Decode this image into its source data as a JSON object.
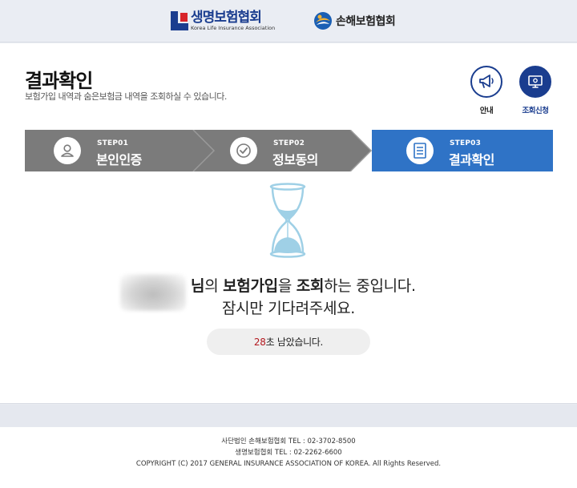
{
  "header": {
    "logo_life_ko": "생명보험협회",
    "logo_life_en": "Korea Life Insurance Association",
    "logo_general_ko": "손해보험협회"
  },
  "main": {
    "title": "결과확인",
    "subtitle": "보험가입 내역과 숨은보험금 내역을 조회하실 수 있습니다.",
    "buttons": {
      "guide_label": "안내",
      "apply_label": "조회신청"
    },
    "steps": [
      {
        "num": "STEP01",
        "name": "본인인증",
        "state": "done"
      },
      {
        "num": "STEP02",
        "name": "정보동의",
        "state": "done"
      },
      {
        "num": "STEP03",
        "name": "결과확인",
        "state": "active"
      }
    ],
    "message": {
      "suffix_nim": "님",
      "particle_ui": "의",
      "bold_insurance": "보험가입",
      "particle_eul": "을",
      "bold_lookup": "조회",
      "tail": "하는 중입니다.",
      "line2": "잠시만 기다려주세요."
    },
    "timer": {
      "seconds": "28",
      "text": "초 남았습니다."
    }
  },
  "footer": {
    "line1": "사단법인 손해보험협회 TEL : 02-3702-8500",
    "line2": "생명보험협회 TEL : 02-2262-6600",
    "line3": "COPYRIGHT (C) 2017 GENERAL INSURANCE ASSOCIATION OF KOREA. All Rights Reserved."
  },
  "colors": {
    "brand_navy": "#1a3d8f",
    "step_done": "#7b7b7b",
    "step_active": "#2f73c6",
    "timer_red": "#b3191f",
    "hourglass_sand": "#9fd0e6"
  }
}
